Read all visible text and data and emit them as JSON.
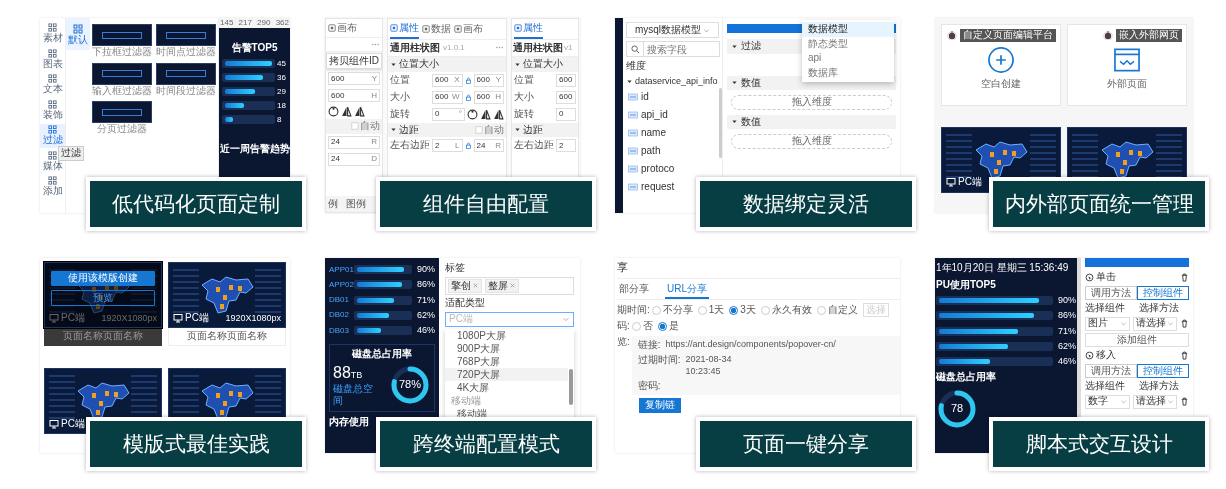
{
  "tiles": [
    {
      "kind": "lowcode",
      "caption": "低代码化页面定制",
      "tooltip": "过滤",
      "sidebar": [
        {
          "label": "素材",
          "selected": false
        },
        {
          "label": "图表",
          "selected": false
        },
        {
          "label": "文本",
          "selected": false
        },
        {
          "label": "装饰",
          "selected": false
        },
        {
          "label": "过滤",
          "selected": true
        },
        {
          "label": "媒体",
          "selected": false
        },
        {
          "label": "添加",
          "selected": false
        }
      ],
      "category": "默认",
      "filters": [
        "下拉框过滤器",
        "时间点过滤器",
        "输入框过滤器",
        "时间段过滤器",
        "分页过滤器"
      ],
      "ruler": [
        "145",
        "217",
        "290",
        "362"
      ],
      "chart_title": "告警TOP5",
      "bars": [
        {
          "value": "45",
          "level": 1
        },
        {
          "value": "36",
          "level": 0.8
        },
        {
          "value": "29",
          "level": 0.64
        },
        {
          "value": "18",
          "level": 0.4
        },
        {
          "value": "8",
          "level": 0.18
        }
      ],
      "trend_title": "近一周告警趋势"
    },
    {
      "kind": "props",
      "caption": "组件自由配置",
      "panels": [
        {
          "tabs": [
            {
              "label": "画布",
              "selected": false
            }
          ],
          "more": true,
          "tooltip": "拷贝组件ID",
          "sections": [
            {
              "rows": [
                {
                  "fields": [
                    {
                      "value": "600",
                      "unit": "Y"
                    }
                  ]
                },
                {
                  "fields": [
                    {
                      "value": "600",
                      "unit": "H"
                    }
                  ]
                },
                {
                  "tools": true
                }
              ]
            },
            {
              "auto": "自动",
              "checked": false,
              "rows": [
                {
                  "fields": [
                    {
                      "value": "24",
                      "unit": "R"
                    }
                  ]
                },
                {
                  "fields": [
                    {
                      "value": "24",
                      "unit": "D"
                    }
                  ]
                }
              ]
            }
          ],
          "footer": [
            "例",
            "图例"
          ]
        },
        {
          "tabs": [
            {
              "label": "属性",
              "selected": true
            },
            {
              "label": "数据",
              "selected": false
            },
            {
              "label": "画布",
              "selected": false
            }
          ],
          "title": "通用柱状图",
          "version": "v1.0.1",
          "more": true,
          "sections": [
            {
              "title": "位置大小",
              "rows": [
                {
                  "label": "位置",
                  "fields": [
                    {
                      "value": "600",
                      "unit": "X"
                    },
                    {
                      "value": "600",
                      "unit": "Y"
                    }
                  ]
                },
                {
                  "label": "大小",
                  "fields": [
                    {
                      "value": "600",
                      "unit": "W"
                    },
                    {
                      "value": "600",
                      "unit": "H"
                    }
                  ]
                },
                {
                  "label": "旋转",
                  "fields": [
                    {
                      "value": "0",
                      "unit": "°"
                    }
                  ],
                  "tools": true
                }
              ]
            },
            {
              "title": "边距",
              "auto": "自动",
              "checked": false,
              "rows": [
                {
                  "label": "左右边距",
                  "fields": [
                    {
                      "value": "2",
                      "unit": "L"
                    },
                    {
                      "value": "24",
                      "unit": "R"
                    }
                  ]
                }
              ]
            }
          ]
        },
        {
          "tabs": [
            {
              "label": "属性",
              "selected": true
            }
          ],
          "title": "通用柱状图",
          "version": "v1",
          "sections": [
            {
              "title": "位置大小",
              "rows": [
                {
                  "label": "位置",
                  "fields": [
                    {
                      "value": "600"
                    }
                  ]
                },
                {
                  "label": "大小",
                  "fields": [
                    {
                      "value": "600"
                    }
                  ]
                },
                {
                  "label": "旋转",
                  "fields": [
                    {
                      "value": "0"
                    }
                  ]
                }
              ]
            },
            {
              "title": "边距",
              "rows": [
                {
                  "label": "左右边距",
                  "fields": [
                    {
                      "value": "2"
                    }
                  ]
                }
              ]
            }
          ]
        }
      ]
    },
    {
      "kind": "binding",
      "caption": "数据绑定灵活",
      "model_select": "mysql数据模型",
      "search_placeholder": "搜索字段",
      "dimension_label": "维度",
      "tree": [
        {
          "label": "dataservice_api_info",
          "expanded": true,
          "children": [
            {
              "label": "id"
            },
            {
              "label": "api_id"
            },
            {
              "label": "name"
            },
            {
              "label": "path"
            },
            {
              "label": "protoco"
            },
            {
              "label": "request"
            }
          ]
        }
      ],
      "sections": [
        {
          "title": "过滤"
        },
        {
          "title": "数值",
          "drop": "拖入维度"
        },
        {
          "title": "数值",
          "drop": "拖入维度"
        }
      ],
      "menu": [
        {
          "label": "数据模型",
          "selected": true
        },
        {
          "label": "静态类型",
          "selected": false
        },
        {
          "label": "api",
          "selected": false
        },
        {
          "label": "数据库",
          "selected": false
        }
      ]
    },
    {
      "kind": "pages",
      "caption": "内外部页面统一管理",
      "cards": [
        {
          "kind": "plus",
          "label": "空白创建",
          "tooltip": "自定义页面编辑平台"
        },
        {
          "kind": "browser",
          "label": "外部页面",
          "tooltip": "嵌入外部网页"
        }
      ],
      "previews": [
        {
          "kind": "dashboard",
          "tag": "PC端"
        },
        {
          "kind": "dashboard"
        }
      ]
    },
    {
      "kind": "templates",
      "caption": "模版式最佳实践",
      "templates": [
        {
          "name": "页面名称页面名称",
          "tag": "PC端",
          "size": "1920X1080px",
          "hovered": true,
          "actions": [
            "使用该模版创建",
            "预览"
          ]
        },
        {
          "name": "页面名称页面名称",
          "tag": "PC端",
          "size": "1920X1080px",
          "hovered": false
        },
        {
          "tag": "PC端",
          "hovered": false
        },
        {
          "hovered": false
        }
      ]
    },
    {
      "kind": "terminal",
      "caption": "跨终端配置模式",
      "bars": [
        {
          "label": "APP01",
          "reading": "90%",
          "level": 0.9
        },
        {
          "label": "APP02",
          "reading": "86%",
          "level": 0.86
        },
        {
          "label": "DB01",
          "reading": "71%",
          "level": 0.71
        },
        {
          "label": "DB02",
          "reading": "62%",
          "level": 0.62
        },
        {
          "label": "DB03",
          "reading": "46%",
          "level": 0.46
        }
      ],
      "disk_title": "磁盘总占用率",
      "disk_total": "88",
      "disk_unit": "TB",
      "disk_label": "磁盘总空间",
      "gauge": {
        "reading": "78%",
        "level": 0.78
      },
      "memory_title": "内存使用",
      "tags_label": "标签",
      "tags": [
        "擎创",
        "整屏"
      ],
      "type_label": "适配类型",
      "type_placeholder": "PC端",
      "options": [
        {
          "kind": "option",
          "label": "1080P大屏",
          "selected": false
        },
        {
          "kind": "option",
          "label": "900P大屏",
          "selected": false
        },
        {
          "kind": "option",
          "label": "768P大屏",
          "selected": false
        },
        {
          "kind": "option",
          "label": "720P大屏",
          "selected": true
        },
        {
          "kind": "option",
          "label": "4K大屏",
          "selected": false
        },
        {
          "kind": "group",
          "label": "移动端"
        },
        {
          "kind": "option",
          "label": "移动端",
          "selected": false
        }
      ]
    },
    {
      "kind": "share",
      "caption": "页面一键分享",
      "header": "享",
      "tabs": [
        {
          "label": "部分享",
          "selected": false
        },
        {
          "label": "URL分享",
          "selected": true
        }
      ],
      "expiry": {
        "label": "期时间:",
        "options": [
          {
            "label": "不分享",
            "selected": false
          },
          {
            "label": "1天",
            "selected": false
          },
          {
            "label": "3天",
            "selected": true
          },
          {
            "label": "永久有效",
            "selected": false
          },
          {
            "label": "自定义",
            "selected": false
          }
        ],
        "placeholder": "选择"
      },
      "password": {
        "label": "码:",
        "options": [
          {
            "label": "否",
            "selected": false
          },
          {
            "label": "是",
            "selected": true
          }
        ]
      },
      "preview": {
        "label": "览:",
        "rows": [
          {
            "label": "链接:",
            "value": "https://ant.design/components/popover-cn/"
          },
          {
            "label": "过期时间:",
            "value": "2021-08-34\n10:23:45"
          },
          {
            "label": "密码:"
          }
        ]
      },
      "button": "复制链"
    },
    {
      "kind": "script",
      "caption": "脚本式交互设计",
      "datetime": "1年10月20日 星期三 15:36:49",
      "chart_title": "PU使用TOP5",
      "bars": [
        {
          "reading": "90%",
          "level": 0.9
        },
        {
          "reading": "86%",
          "level": 0.86
        },
        {
          "reading": "71%",
          "level": 0.71
        },
        {
          "reading": "62%",
          "level": 0.62
        },
        {
          "reading": "46%",
          "level": 0.46
        }
      ],
      "disk_title": "磁盘总占用率",
      "gauge": {
        "reading": "78",
        "level": 0.78
      },
      "events": [
        {
          "title": "单击",
          "modes": [
            {
              "label": "调用方法",
              "selected": false
            },
            {
              "label": "控制组件",
              "selected": true
            }
          ],
          "component_label": "选择组件",
          "method_label": "选择方法",
          "component": "图片",
          "method": "请选择",
          "add": "添加组件"
        },
        {
          "title": "移入",
          "modes": [
            {
              "label": "调用方法",
              "selected": false
            },
            {
              "label": "控制组件",
              "selected": true
            }
          ],
          "component_label": "选择组件",
          "method_label": "选择方法",
          "component": "数字",
          "method": "请选择"
        }
      ]
    }
  ]
}
